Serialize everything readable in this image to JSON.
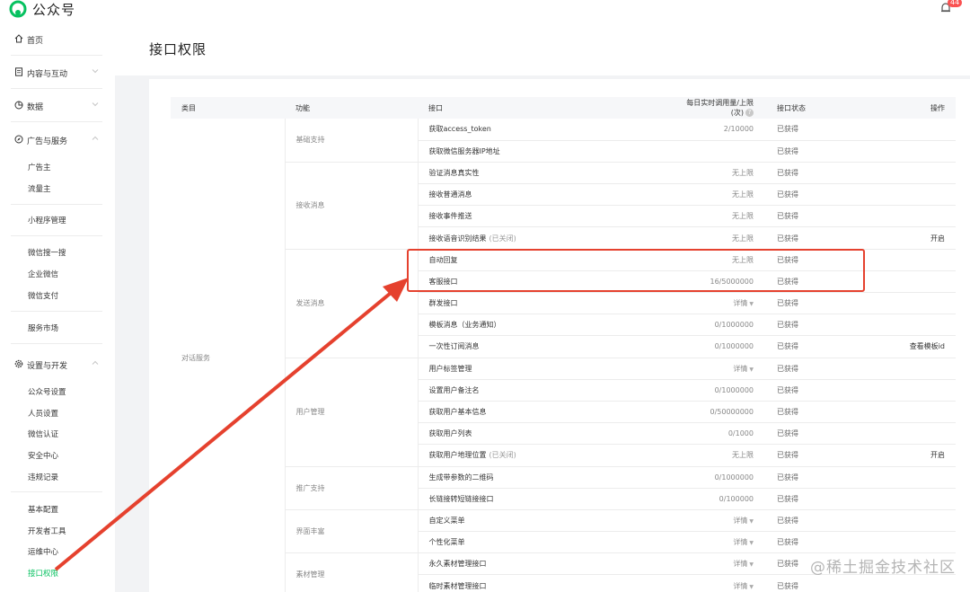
{
  "app": {
    "brand": "公众号",
    "notifications": "44"
  },
  "sidebar": {
    "home": "首页",
    "content": "内容与互动",
    "data": "数据",
    "ads": {
      "label": "广告与服务",
      "items": [
        "广告主",
        "流量主",
        "小程序管理",
        "微信搜一搜",
        "企业微信",
        "微信支付",
        "服务市场"
      ]
    },
    "settings": {
      "label": "设置与开发",
      "items": [
        "公众号设置",
        "人员设置",
        "微信认证",
        "安全中心",
        "违规记录",
        "基本配置",
        "开发者工具",
        "运维中心",
        "接口权限"
      ]
    }
  },
  "page": {
    "title": "接口权限"
  },
  "table": {
    "headers": {
      "category": "类目",
      "function": "功能",
      "api": "接口",
      "usage": "每日实时调用量/上限(次)",
      "status": "接口状态",
      "action": "操作"
    },
    "category": "对话服务",
    "groups": [
      {
        "name": "基础支持",
        "rows": [
          {
            "api": "获取access_token",
            "usage": "2/10000",
            "status": "已获得",
            "action": ""
          },
          {
            "api": "获取微信服务器IP地址",
            "usage": "",
            "status": "已获得",
            "action": ""
          }
        ]
      },
      {
        "name": "接收消息",
        "rows": [
          {
            "api": "验证消息真实性",
            "usage": "无上限",
            "status": "已获得",
            "action": ""
          },
          {
            "api": "接收普通消息",
            "usage": "无上限",
            "status": "已获得",
            "action": ""
          },
          {
            "api": "接收事件推送",
            "usage": "无上限",
            "status": "已获得",
            "action": ""
          },
          {
            "api": "接收语音识别结果",
            "note": "(已关闭)",
            "usage": "无上限",
            "status": "已获得",
            "action": "开启"
          }
        ]
      },
      {
        "name": "发送消息",
        "rows": [
          {
            "api": "自动回复",
            "usage": "无上限",
            "status": "已获得",
            "action": ""
          },
          {
            "api": "客服接口",
            "usage": "16/5000000",
            "status": "已获得",
            "action": ""
          },
          {
            "api": "群发接口",
            "usage": "详情",
            "status": "已获得",
            "action": ""
          },
          {
            "api": "模板消息（业务通知）",
            "usage": "0/1000000",
            "status": "已获得",
            "action": ""
          },
          {
            "api": "一次性订阅消息",
            "usage": "0/1000000",
            "status": "已获得",
            "action": "查看模板id"
          }
        ]
      },
      {
        "name": "用户管理",
        "rows": [
          {
            "api": "用户标签管理",
            "usage": "详情",
            "status": "已获得",
            "action": ""
          },
          {
            "api": "设置用户备注名",
            "usage": "0/1000000",
            "status": "已获得",
            "action": ""
          },
          {
            "api": "获取用户基本信息",
            "usage": "0/50000000",
            "status": "已获得",
            "action": ""
          },
          {
            "api": "获取用户列表",
            "usage": "0/1000",
            "status": "已获得",
            "action": ""
          },
          {
            "api": "获取用户地理位置",
            "note": "(已关闭)",
            "usage": "无上限",
            "status": "已获得",
            "action": "开启"
          }
        ]
      },
      {
        "name": "推广支持",
        "rows": [
          {
            "api": "生成带参数的二维码",
            "usage": "0/1000000",
            "status": "已获得",
            "action": ""
          },
          {
            "api": "长链接转短链接接口",
            "usage": "0/100000",
            "status": "已获得",
            "action": ""
          }
        ]
      },
      {
        "name": "界面丰富",
        "rows": [
          {
            "api": "自定义菜单",
            "usage": "详情",
            "status": "已获得",
            "action": ""
          },
          {
            "api": "个性化菜单",
            "usage": "详情",
            "status": "已获得",
            "action": ""
          }
        ]
      },
      {
        "name": "素材管理",
        "rows": [
          {
            "api": "永久素材管理接口",
            "usage": "详情",
            "status": "已获得",
            "action": ""
          },
          {
            "api": "临时素材管理接口",
            "usage": "详情",
            "status": "已获得",
            "action": ""
          }
        ]
      }
    ]
  },
  "watermark": "@稀土掘金技术社区",
  "colors": {
    "accent_green": "#07c160",
    "annotation_red": "#e5412e"
  }
}
